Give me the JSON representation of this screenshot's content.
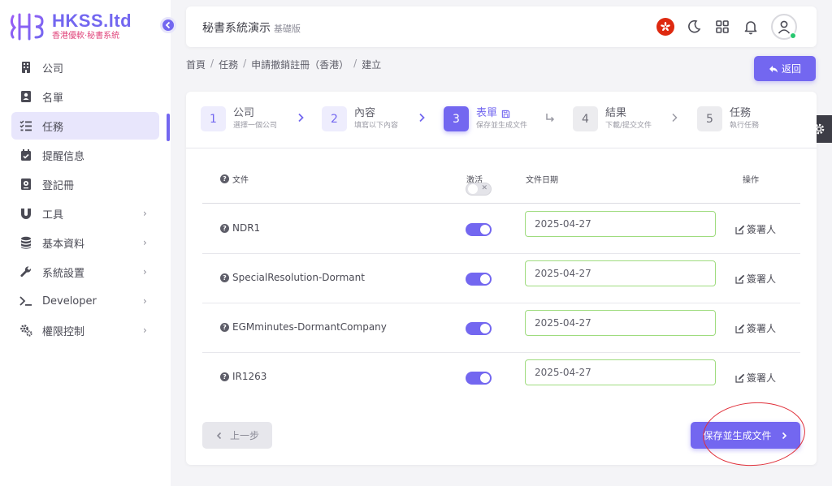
{
  "logo": {
    "title": "HKSS.ltd",
    "subtitle": "香港優軟·秘書系統"
  },
  "sidebar": {
    "items": [
      {
        "label": "公司",
        "icon": "building-icon"
      },
      {
        "label": "名單",
        "icon": "contact-book-icon"
      },
      {
        "label": "任務",
        "icon": "task-list-icon",
        "active": true
      },
      {
        "label": "提醒信息",
        "icon": "calendar-check-icon"
      },
      {
        "label": "登記冊",
        "icon": "register-book-icon"
      },
      {
        "label": "工具",
        "icon": "magnet-icon",
        "has_submenu": true
      },
      {
        "label": "基本資料",
        "icon": "database-icon",
        "has_submenu": true
      },
      {
        "label": "系統設置",
        "icon": "wrench-icon",
        "has_submenu": true
      },
      {
        "label": "Developer",
        "icon": "terminal-icon",
        "has_submenu": true
      },
      {
        "label": "權限控制",
        "icon": "gears-icon",
        "has_submenu": true
      }
    ]
  },
  "topbar": {
    "title": "秘書系統演示",
    "edition": "基礎版",
    "icons": [
      "hk-flag-icon",
      "moon-icon",
      "grid-icon",
      "bell-icon",
      "user-avatar-icon"
    ]
  },
  "breadcrumb": [
    "首頁",
    "任務",
    "申請撤銷註冊（香港）",
    "建立"
  ],
  "back_button": {
    "label": "返回"
  },
  "stepper": [
    {
      "num": "1",
      "title": "公司",
      "sub": "選擇一個公司",
      "state": "done"
    },
    {
      "num": "2",
      "title": "內容",
      "sub": "填寫以下內容",
      "state": "done"
    },
    {
      "num": "3",
      "title": "表單",
      "sub": "保存並生成文件",
      "state": "active"
    },
    {
      "num": "4",
      "title": "結果",
      "sub": "下載/提交文件",
      "state": "pending"
    },
    {
      "num": "5",
      "title": "任務",
      "sub": "執行任務",
      "state": "pending"
    }
  ],
  "table": {
    "headers": {
      "file": "文件",
      "active": "激活",
      "date": "文件日期",
      "action": "操作"
    },
    "rows": [
      {
        "file": "NDR1",
        "active": true,
        "date": "2025-04-27",
        "action": "簽署人"
      },
      {
        "file": "SpecialResolution-Dormant",
        "active": true,
        "date": "2025-04-27",
        "action": "簽署人"
      },
      {
        "file": "EGMminutes-DormantCompany",
        "active": true,
        "date": "2025-04-27",
        "action": "簽署人"
      },
      {
        "file": "IR1263",
        "active": true,
        "date": "2025-04-27",
        "action": "簽署人"
      }
    ]
  },
  "buttons": {
    "prev": "上一步",
    "save": "保存並生成文件"
  },
  "colors": {
    "accent": "#7367f0",
    "annotation": "#e0303a"
  }
}
